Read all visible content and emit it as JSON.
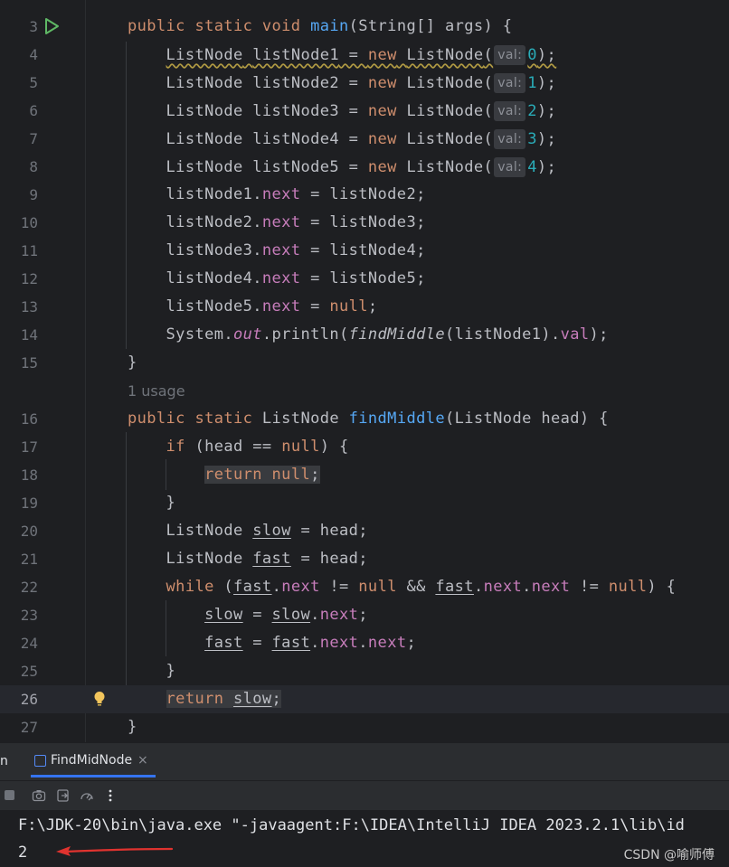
{
  "editor": {
    "line_numbers": [
      "3",
      "4",
      "5",
      "6",
      "7",
      "8",
      "9",
      "10",
      "11",
      "12",
      "13",
      "14",
      "15",
      "16",
      "17",
      "18",
      "19",
      "20",
      "21",
      "22",
      "23",
      "24",
      "25",
      "26",
      "27"
    ],
    "tokens": {
      "public": "public",
      "static": "static",
      "void": "void",
      "main": "main",
      "string_args": "(String[] args) {",
      "listnode": "ListNode",
      "new": "new",
      "null": "null",
      "return": "return",
      "if": "if",
      "while": "while",
      "decl": [
        "listNode1",
        "listNode2",
        "listNode3",
        "listNode4",
        "listNode5"
      ],
      "vals": [
        "0",
        "1",
        "2",
        "3",
        "4"
      ],
      "next": "next",
      "val_field": "val",
      "system": "System.",
      "out": "out",
      "println": ".println(",
      "findMiddle": "findMiddle",
      "head": "head",
      "slow": "slow",
      "fast": "fast"
    },
    "hint_label": "val:",
    "usage_hint": "1 usage",
    "method_sig_params": "(ListNode head) {"
  },
  "panel": {
    "prev_tab_fragment": "n",
    "run_tab_label": "FindMidNode",
    "close_glyph": "×",
    "console_lines": [
      "F:\\JDK-20\\bin\\java.exe \"-javaagent:F:\\IDEA\\IntelliJ IDEA 2023.2.1\\lib\\id",
      "2"
    ]
  },
  "watermark": "CSDN @喻师傅",
  "colors": {
    "keyword": "#cf8e6d",
    "method": "#56a8f5",
    "field": "#c77dbb",
    "number": "#2aacb8",
    "arrow": "#e0332f",
    "run": "#5fb865"
  }
}
